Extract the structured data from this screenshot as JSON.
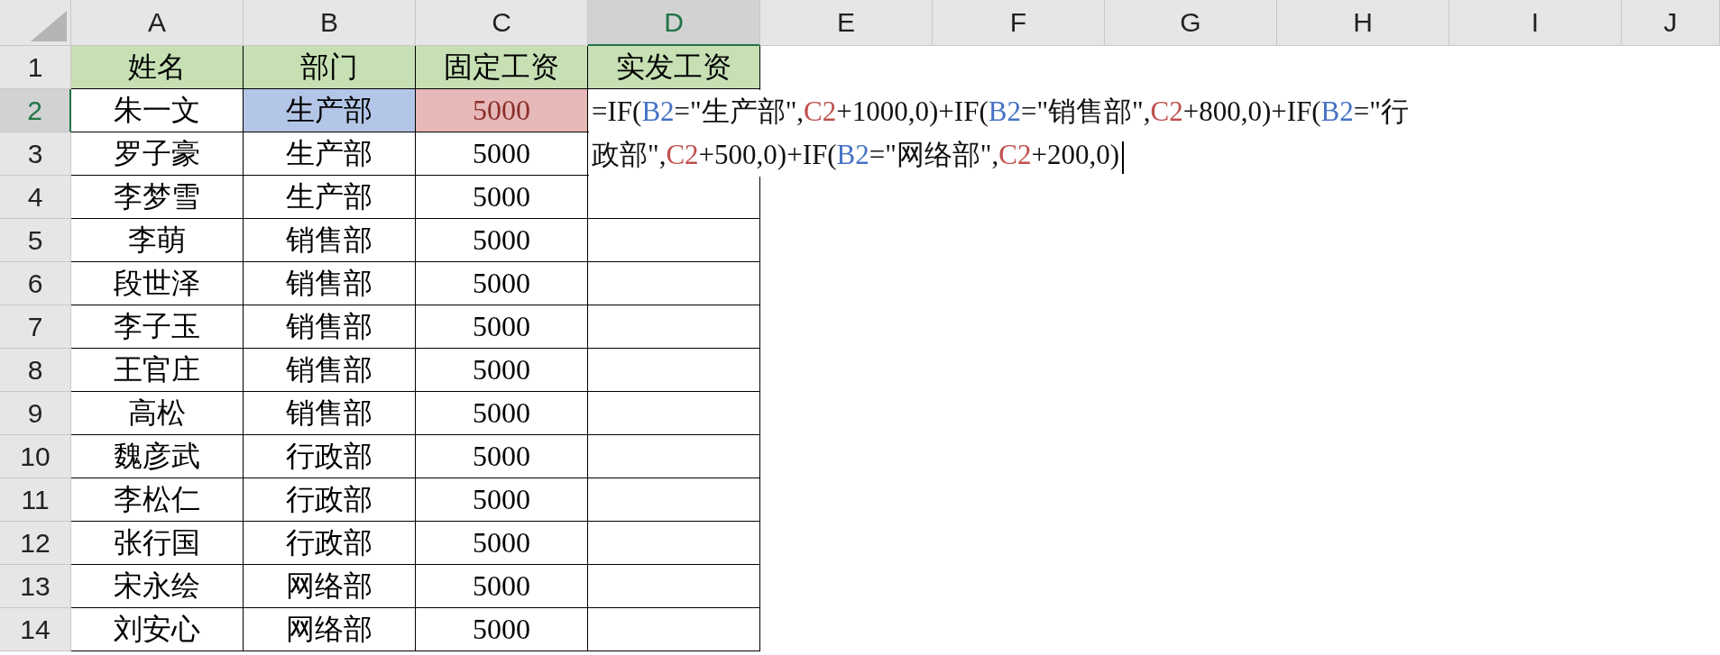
{
  "columns": [
    {
      "label": "A",
      "selected": false
    },
    {
      "label": "B",
      "selected": false
    },
    {
      "label": "C",
      "selected": false
    },
    {
      "label": "D",
      "selected": true
    },
    {
      "label": "E",
      "selected": false
    },
    {
      "label": "F",
      "selected": false
    },
    {
      "label": "G",
      "selected": false
    },
    {
      "label": "H",
      "selected": false
    },
    {
      "label": "I",
      "selected": false
    },
    {
      "label": "J",
      "selected": false
    }
  ],
  "rows": [
    {
      "number": "1",
      "selected": false,
      "cells": [
        {
          "kind": "header",
          "text": "姓名"
        },
        {
          "kind": "header",
          "text": "部门"
        },
        {
          "kind": "header",
          "text": "固定工资"
        },
        {
          "kind": "header",
          "text": "实发工资"
        }
      ]
    },
    {
      "number": "2",
      "selected": true,
      "cells": [
        {
          "kind": "text",
          "text": "朱一文"
        },
        {
          "kind": "text",
          "text": "生产部",
          "color": "#b4c6e7"
        },
        {
          "kind": "text",
          "text": "5000",
          "color": "#e6b8b7"
        },
        {
          "kind": "formula",
          "lines": [
            [
              {
                "text": "=IF("
              },
              {
                "text": "B2",
                "color": "#4472c4"
              },
              {
                "text": "=\"生产部\","
              },
              {
                "text": "C2",
                "color": "#c0504d"
              },
              {
                "text": "+1000,0)+IF("
              },
              {
                "text": "B2",
                "color": "#4472c4"
              },
              {
                "text": "=\"销售部\","
              },
              {
                "text": "C2",
                "color": "#c0504d"
              },
              {
                "text": "+800,0)+IF("
              },
              {
                "text": "B2",
                "color": "#4472c4"
              },
              {
                "text": "=\"行"
              }
            ],
            [
              {
                "text": "政部\","
              },
              {
                "text": "C2",
                "color": "#c0504d"
              },
              {
                "text": "+500,0)+IF("
              },
              {
                "text": "B2",
                "color": "#4472c4"
              },
              {
                "text": "=\"网络部\","
              },
              {
                "text": "C2",
                "color": "#c0504d"
              },
              {
                "text": "+200,0)"
              }
            ]
          ]
        }
      ]
    },
    {
      "number": "3",
      "selected": false,
      "cells": [
        {
          "kind": "text",
          "text": "罗子豪"
        },
        {
          "kind": "text",
          "text": "生产部"
        },
        {
          "kind": "text",
          "text": "5000"
        }
      ]
    },
    {
      "number": "4",
      "selected": false,
      "cells": [
        {
          "kind": "text",
          "text": "李梦雪"
        },
        {
          "kind": "text",
          "text": "生产部"
        },
        {
          "kind": "text",
          "text": "5000"
        }
      ]
    },
    {
      "number": "5",
      "selected": false,
      "cells": [
        {
          "kind": "text",
          "text": "李萌"
        },
        {
          "kind": "text",
          "text": "销售部"
        },
        {
          "kind": "text",
          "text": "5000"
        }
      ]
    },
    {
      "number": "6",
      "selected": false,
      "cells": [
        {
          "kind": "text",
          "text": "段世泽"
        },
        {
          "kind": "text",
          "text": "销售部"
        },
        {
          "kind": "text",
          "text": "5000"
        }
      ]
    },
    {
      "number": "7",
      "selected": false,
      "cells": [
        {
          "kind": "text",
          "text": "李子玉"
        },
        {
          "kind": "text",
          "text": "销售部"
        },
        {
          "kind": "text",
          "text": "5000"
        }
      ]
    },
    {
      "number": "8",
      "selected": false,
      "cells": [
        {
          "kind": "text",
          "text": "王官庄"
        },
        {
          "kind": "text",
          "text": "销售部"
        },
        {
          "kind": "text",
          "text": "5000"
        }
      ]
    },
    {
      "number": "9",
      "selected": false,
      "cells": [
        {
          "kind": "text",
          "text": "高松"
        },
        {
          "kind": "text",
          "text": "销售部"
        },
        {
          "kind": "text",
          "text": "5000"
        }
      ]
    },
    {
      "number": "10",
      "selected": false,
      "cells": [
        {
          "kind": "text",
          "text": "魏彦武"
        },
        {
          "kind": "text",
          "text": "行政部"
        },
        {
          "kind": "text",
          "text": "5000"
        }
      ]
    },
    {
      "number": "11",
      "selected": false,
      "cells": [
        {
          "kind": "text",
          "text": "李松仁"
        },
        {
          "kind": "text",
          "text": "行政部"
        },
        {
          "kind": "text",
          "text": "5000"
        }
      ]
    },
    {
      "number": "12",
      "selected": false,
      "cells": [
        {
          "kind": "text",
          "text": "张行国"
        },
        {
          "kind": "text",
          "text": "行政部"
        },
        {
          "kind": "text",
          "text": "5000"
        }
      ]
    },
    {
      "number": "13",
      "selected": false,
      "cells": [
        {
          "kind": "text",
          "text": "宋永绘"
        },
        {
          "kind": "text",
          "text": "网络部"
        },
        {
          "kind": "text",
          "text": "5000"
        }
      ]
    },
    {
      "number": "14",
      "selected": false,
      "cells": [
        {
          "kind": "text",
          "text": "刘安心"
        },
        {
          "kind": "text",
          "text": "网络部"
        },
        {
          "kind": "text",
          "text": "5000"
        }
      ]
    }
  ]
}
